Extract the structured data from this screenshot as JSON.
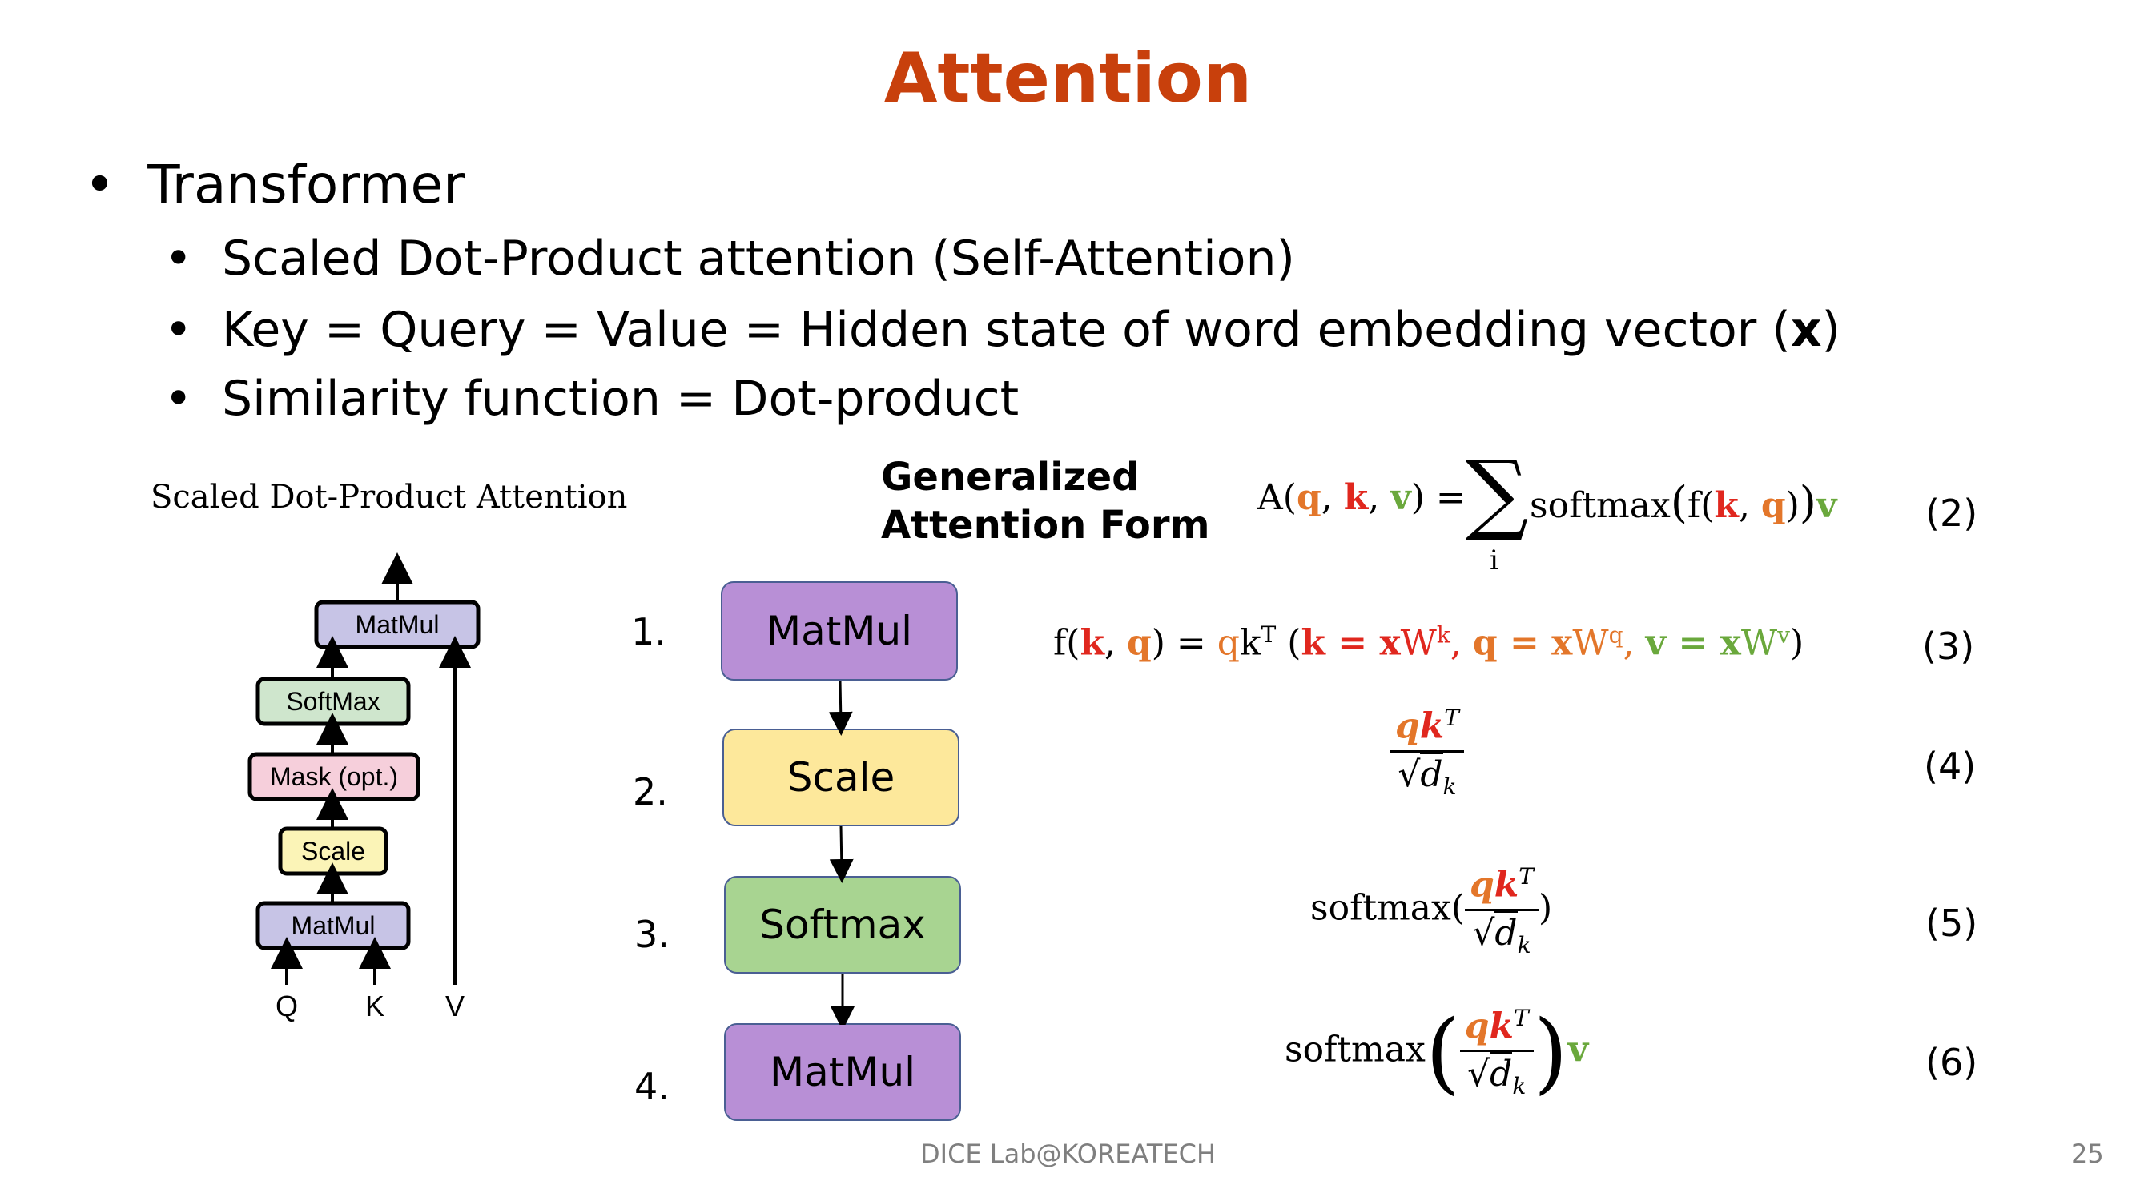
{
  "title": "Attention",
  "bullets": {
    "main": "Transformer",
    "sub1": "Scaled Dot-Product attention (Self-Attention)",
    "sub2_prefix": "Key = Query = Value = Hidden state of word embedding vector (",
    "sub2_bold": "x",
    "sub2_suffix": ")",
    "sub3": "Similarity function = Dot-product"
  },
  "left_diagram": {
    "caption": "Scaled Dot-Product Attention",
    "blocks": [
      "MatMul",
      "SoftMax",
      "Mask (opt.)",
      "Scale",
      "MatMul"
    ],
    "inputs": [
      "Q",
      "K",
      "V"
    ]
  },
  "flow": {
    "numbers": [
      "1.",
      "2.",
      "3.",
      "4."
    ],
    "steps": [
      "MatMul",
      "Scale",
      "Softmax",
      "MatMul"
    ]
  },
  "generalized_label": [
    "Generalized",
    "Attention Form"
  ],
  "equations": {
    "eq_numbers": [
      "(2)",
      "(3)",
      "(4)",
      "(5)",
      "(6)"
    ],
    "sym_q": "q",
    "sym_k": "k",
    "sym_v": "v",
    "sym_x": "x",
    "softmax": "softmax",
    "sum_index": "i",
    "eq2_A": "A",
    "eq3_f": "f",
    "eq3_qk": "qk",
    "sup_T": "T",
    "W": "W",
    "frac_qk": "qk",
    "frac_dk": "d",
    "frac_dk_sub": "k"
  },
  "colors": {
    "title": "#c8400c",
    "q": "#e3762a",
    "k": "#e0271e",
    "v": "#6aa83c",
    "matmul": "#b88fd6",
    "scale": "#fde89b",
    "softmax": "#a8d491"
  },
  "footer": {
    "lab": "DICE Lab@KOREATECH",
    "page": "25"
  }
}
